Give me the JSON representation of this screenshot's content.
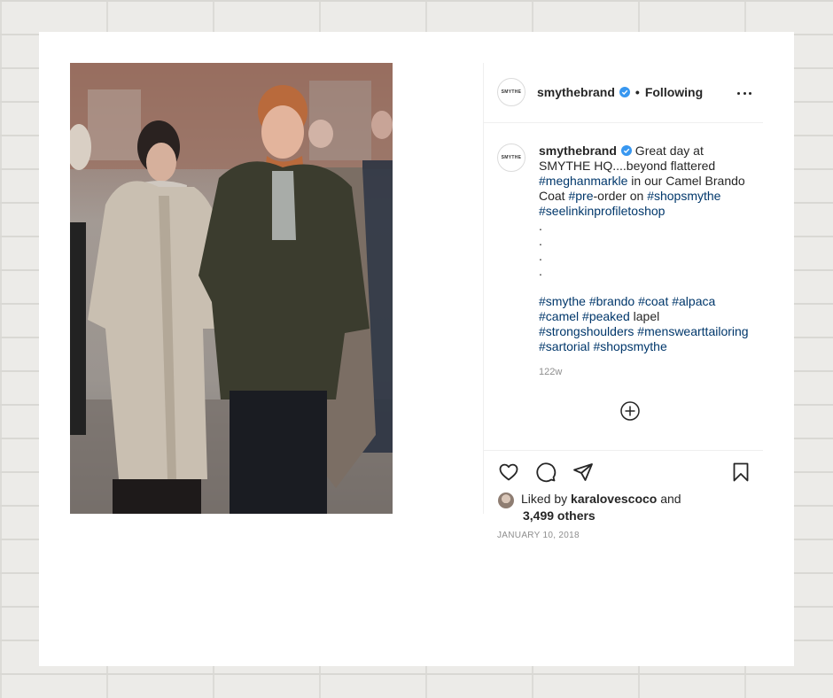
{
  "post": {
    "header": {
      "avatar_text": "SMYTHE",
      "username": "smythebrand",
      "separator": "•",
      "follow_state": "Following"
    },
    "caption": {
      "avatar_text": "SMYTHE",
      "username": "smythebrand",
      "text_1": " Great day at SMYTHE HQ....beyond flattered ",
      "tag_1": "#meghanmarkle",
      "text_2": " in our Camel Brando Coat ",
      "tag_2": "#pre",
      "text_3": "-order on ",
      "tag_3": "#shopsmythe",
      "tag_4": "#seelinkinprofiletoshop",
      "dot_1": ".",
      "dot_2": ".",
      "dot_3": ".",
      "dot_4": ".",
      "tag_5": "#smythe",
      "tag_6": "#brando",
      "tag_7": "#coat",
      "tag_8": "#alpaca",
      "tag_9": "#camel",
      "tag_10": "#peaked",
      "text_4": " lapel",
      "tag_11": "#strongshoulders",
      "tag_12": "#menswearttailoring",
      "tag_13": "#sartorial",
      "tag_14": "#shopsmythe",
      "time_ago": "122w"
    },
    "likes": {
      "prefix": "Liked by ",
      "user": "karalovescoco",
      "suffix": " and",
      "count": "3,499 others"
    },
    "date": "JANUARY 10, 2018",
    "icons": {
      "verified": "verified-badge-icon",
      "more": "more-options-icon",
      "load_more": "plus-circle-icon",
      "like": "heart-icon",
      "comment": "comment-icon",
      "share": "share-icon",
      "save": "bookmark-icon"
    },
    "colors": {
      "link": "#00376b",
      "verified": "#3897f0",
      "muted": "#8e8e8e"
    }
  }
}
